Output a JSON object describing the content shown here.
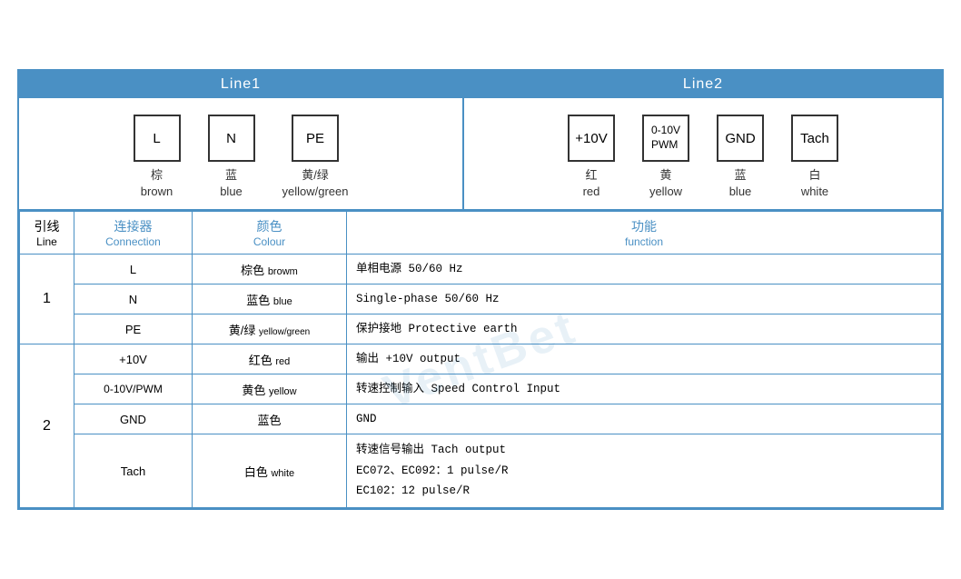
{
  "header": {
    "line1_label": "Line1",
    "line2_label": "Line2"
  },
  "line1_connectors": [
    {
      "id": "L",
      "label_cn": "棕",
      "label_en": "brown"
    },
    {
      "id": "N",
      "label_cn": "蓝",
      "label_en": "blue"
    },
    {
      "id": "PE",
      "label_cn": "黄/绿",
      "label_en": "yellow/green"
    }
  ],
  "line2_connectors": [
    {
      "id": "+10V",
      "label_cn": "红",
      "label_en": "red"
    },
    {
      "id": "0-10V\nPWM",
      "label_cn": "黄",
      "label_en": "yellow"
    },
    {
      "id": "GND",
      "label_cn": "蓝",
      "label_en": "blue"
    },
    {
      "id": "Tach",
      "label_cn": "白",
      "label_en": "white"
    }
  ],
  "table": {
    "headers": {
      "line_cn": "引线",
      "line_en": "Line",
      "connection_cn": "连接器",
      "connection_en": "Connection",
      "colour_cn": "颜色",
      "colour_en": "Colour",
      "function_cn": "功能",
      "function_en": "function"
    },
    "rows": [
      {
        "line": "1",
        "rowspan": 3,
        "entries": [
          {
            "connection": "L",
            "colour_cn": "棕色",
            "colour_en": "browm",
            "function": "单相电源 50/60 Hz\nSingle-phase 50/60 Hz"
          },
          {
            "connection": "N",
            "colour_cn": "蓝色",
            "colour_en": "blue",
            "function": "Single-phase 50/60 Hz"
          },
          {
            "connection": "PE",
            "colour_cn": "黄/绿",
            "colour_en": "yellow/green",
            "function": "保护接地 Protective earth"
          }
        ]
      },
      {
        "line": "2",
        "rowspan": 4,
        "entries": [
          {
            "connection": "+10V",
            "colour_cn": "红色",
            "colour_en": "red",
            "function": "输出 +10V output"
          },
          {
            "connection": "0-10V/PWM",
            "colour_cn": "黄色",
            "colour_en": "yellow",
            "function": "转速控制输入 Speed Control Input"
          },
          {
            "connection": "GND",
            "colour_cn": "蓝色",
            "colour_en": "",
            "function": "GND"
          },
          {
            "connection": "Tach",
            "colour_cn": "白色",
            "colour_en": "white",
            "function": "转速信号输出 Tach output\nEC072、EC092：1 pulse/R\nEC102：12 pulse/R"
          }
        ]
      }
    ]
  },
  "watermark_text": "VentBet"
}
